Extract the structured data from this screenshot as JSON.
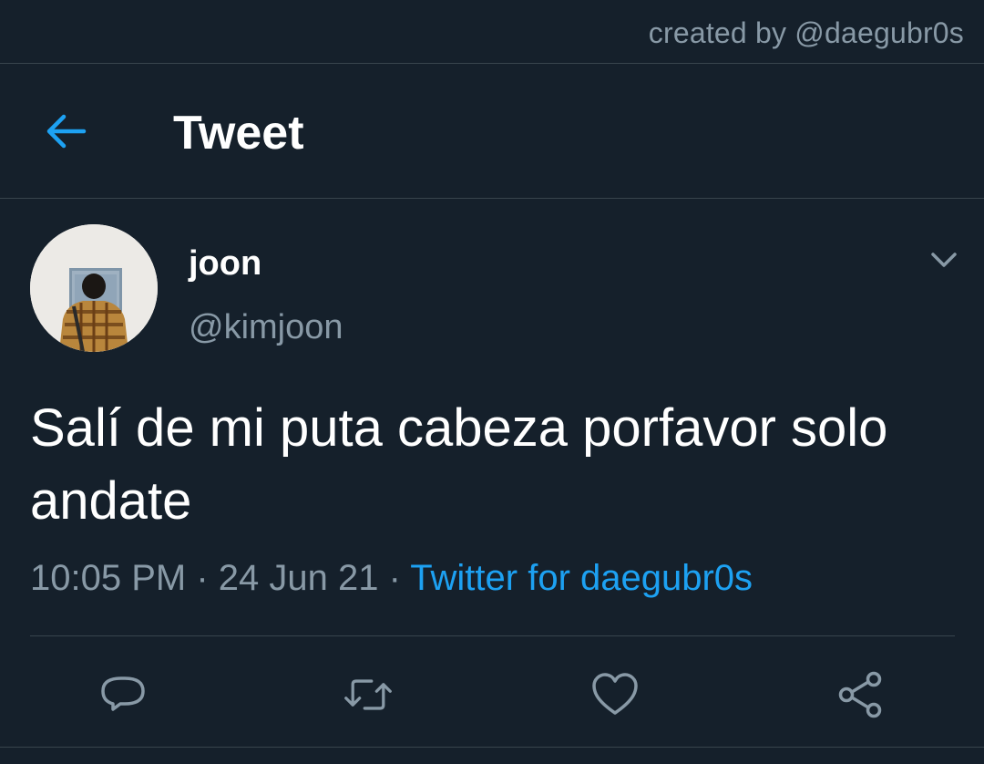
{
  "credit": {
    "text": "created by @daegubr0s"
  },
  "header": {
    "title": "Tweet",
    "back_icon": "arrow-left-icon"
  },
  "tweet": {
    "author_name": "joon",
    "author_handle": "@kimjoon",
    "text": "Salí de mi puta cabeza porfavor solo andate",
    "time": "10:05 PM",
    "date": "24 Jun 21",
    "separator": " · ",
    "source": "Twitter for daegubr0s"
  },
  "actions": {
    "reply_icon": "reply-icon",
    "retweet_icon": "retweet-icon",
    "like_icon": "heart-icon",
    "share_icon": "share-icon"
  },
  "colors": {
    "background": "#15202b",
    "accent": "#1da1f2",
    "secondary_text": "#8899a6",
    "border": "#38444d",
    "primary_text": "#ffffff"
  }
}
